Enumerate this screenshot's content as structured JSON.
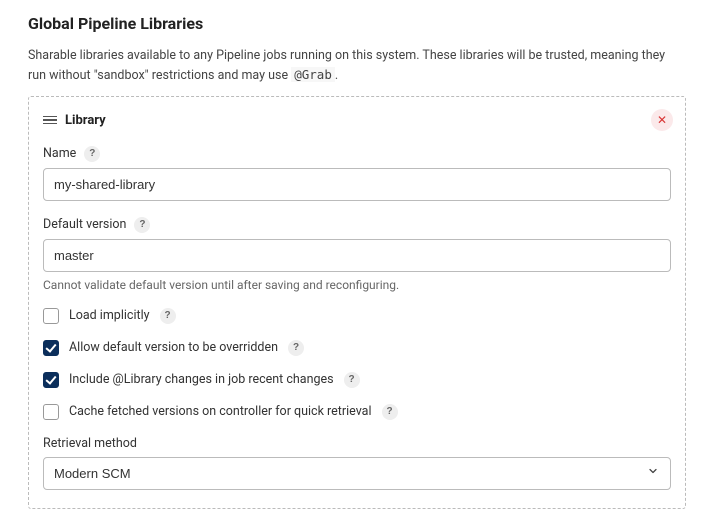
{
  "title": "Global Pipeline Libraries",
  "description_before_code": "Sharable libraries available to any Pipeline jobs running on this system. These libraries will be trusted, meaning they run without \"sandbox\" restrictions and may use ",
  "description_code": "@Grab",
  "description_after_code": ".",
  "library": {
    "header": "Library",
    "close_glyph": "✕",
    "help_glyph": "?",
    "name_label": "Name",
    "name_value": "my-shared-library",
    "default_version_label": "Default version",
    "default_version_value": "master",
    "default_version_hint": "Cannot validate default version until after saving and reconfiguring.",
    "checkboxes": [
      {
        "label": "Load implicitly",
        "checked": false
      },
      {
        "label": "Allow default version to be overridden",
        "checked": true
      },
      {
        "label": "Include @Library changes in job recent changes",
        "checked": true
      },
      {
        "label": "Cache fetched versions on controller for quick retrieval",
        "checked": false
      }
    ],
    "retrieval_label": "Retrieval method",
    "retrieval_value": "Modern SCM"
  }
}
